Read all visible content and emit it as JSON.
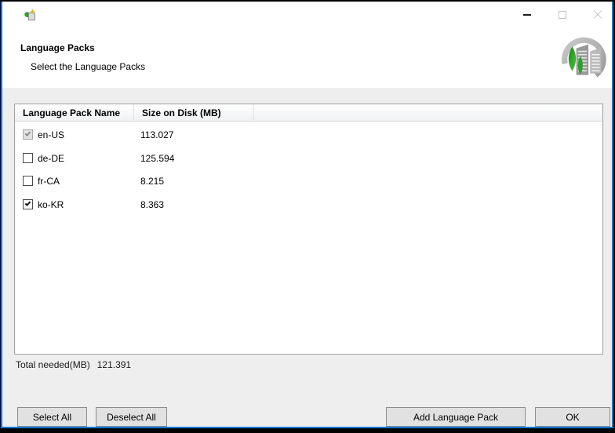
{
  "header": {
    "title": "Language Packs",
    "subtitle": "Select the Language Packs"
  },
  "table": {
    "columns": [
      {
        "label": "Language Pack Name"
      },
      {
        "label": "Size on Disk (MB)"
      }
    ],
    "rows": [
      {
        "name": "en-US",
        "size_mb": "113.027",
        "checked": true,
        "disabled": true
      },
      {
        "name": "de-DE",
        "size_mb": "125.594",
        "checked": false,
        "disabled": false
      },
      {
        "name": "fr-CA",
        "size_mb": "8.215",
        "checked": false,
        "disabled": false
      },
      {
        "name": "ko-KR",
        "size_mb": "8.363",
        "checked": true,
        "disabled": false
      }
    ]
  },
  "summary": {
    "label": "Total needed(MB)",
    "value": "121.391"
  },
  "buttons": {
    "select_all": "Select All",
    "deselect_all": "Deselect All",
    "add_language_pack": "Add Language Pack",
    "ok": "OK"
  },
  "icons": {
    "titlebar": "app-icon",
    "minimize": "minimize-icon",
    "maximize": "maximize-icon",
    "close": "close-icon",
    "logo": "language-packs-logo"
  },
  "colors": {
    "accent_border": "#0078d7",
    "frame": "#020202",
    "body_bg": "#eeeeee",
    "header_bg": "#ffffff",
    "table_border": "#a0a0a0",
    "button_bg": "#e1e1e1",
    "button_border": "#8c8c8c",
    "tree_green": "#2e9e2e"
  }
}
